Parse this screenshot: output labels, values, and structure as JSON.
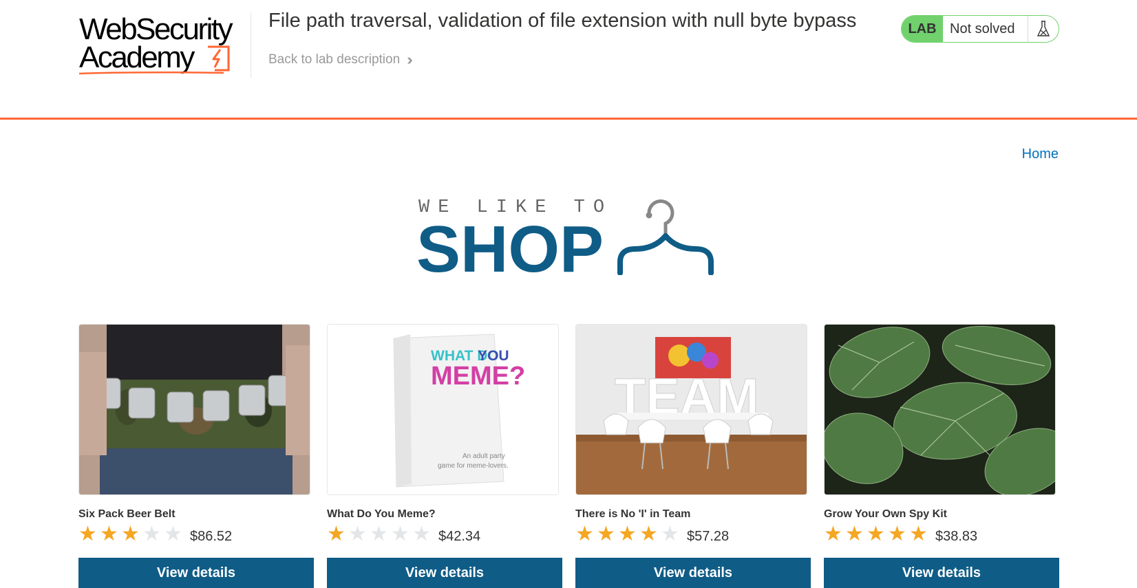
{
  "header": {
    "logo": {
      "line1": "WebSecurity",
      "line2": "Academy"
    },
    "lab_title": "File path traversal, validation of file extension with null byte bypass",
    "back_link": "Back to lab description",
    "status": {
      "badge": "LAB",
      "text": "Not solved",
      "icon": "flask-icon"
    }
  },
  "nav": {
    "home": "Home"
  },
  "banner": {
    "tagline": "WE LIKE TO",
    "title": "SHOP",
    "icon": "hanger-icon"
  },
  "colors": {
    "accent_orange": "#ff6633",
    "brand_blue": "#0f5c87",
    "link_blue": "#0071bc",
    "lab_green": "#70d16d",
    "star_gold": "#f5a623"
  },
  "products": [
    {
      "name": "Six Pack Beer Belt",
      "rating": 3,
      "price": "$86.52",
      "button": "View details",
      "image": "beer-belt-photo"
    },
    {
      "name": "What Do You Meme?",
      "rating": 1,
      "price": "$42.34",
      "button": "View details",
      "image": "meme-game-box-photo"
    },
    {
      "name": "There is No 'I' in Team",
      "rating": 4,
      "price": "$57.28",
      "button": "View details",
      "image": "team-letters-photo"
    },
    {
      "name": "Grow Your Own Spy Kit",
      "rating": 5,
      "price": "$38.83",
      "button": "View details",
      "image": "green-leaves-photo"
    }
  ],
  "product_images": {
    "meme_box": {
      "line1a": "WHAT DO",
      "line1b": "YOU",
      "line2": "MEME?",
      "caption1": "An adult party",
      "caption2": "game for meme-lovers."
    },
    "team_sign": "TEAM"
  }
}
